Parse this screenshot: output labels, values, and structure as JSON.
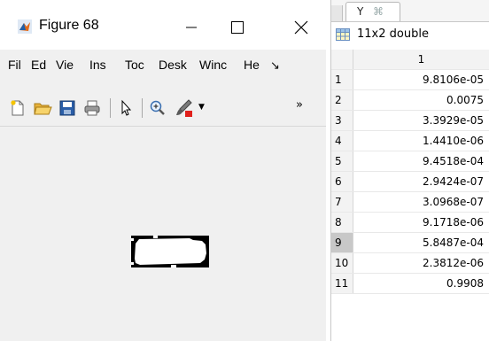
{
  "figure_window": {
    "title": "Figure 68",
    "menu": {
      "file": "Fil",
      "edit": "Ed",
      "view": "Vie",
      "insert": "Ins",
      "tools": "Toc",
      "desktop": "Desk",
      "window": "Winc",
      "help": "He",
      "more": "↘"
    },
    "toolbar": {
      "icons": [
        "new-figure-icon",
        "open-folder-icon",
        "save-icon",
        "print-icon",
        "pointer-icon",
        "zoom-in-icon",
        "brush-icon"
      ],
      "overflow": "»"
    },
    "window_buttons": [
      "minimize-icon",
      "maximize-icon",
      "close-icon"
    ]
  },
  "variable_editor": {
    "tab_label": "Y",
    "tab_close_glyph": "⌘",
    "info_label": "11x2 double",
    "column_headers": [
      "1"
    ],
    "rows": [
      {
        "index": "1",
        "value": "9.8106e-05"
      },
      {
        "index": "2",
        "value": "0.0075"
      },
      {
        "index": "3",
        "value": "3.3929e-05"
      },
      {
        "index": "4",
        "value": "1.4410e-06"
      },
      {
        "index": "5",
        "value": "9.4518e-04"
      },
      {
        "index": "6",
        "value": "2.9424e-07"
      },
      {
        "index": "7",
        "value": "3.0968e-07"
      },
      {
        "index": "8",
        "value": "9.1718e-06"
      },
      {
        "index": "9",
        "value": "5.8487e-04"
      },
      {
        "index": "10",
        "value": "2.3812e-06"
      },
      {
        "index": "11",
        "value": "0.9908"
      }
    ],
    "selected_row_index": "9"
  },
  "colors": {
    "matlab_icon_orange": "#e06a1b",
    "matlab_icon_blue": "#1f5fa8",
    "brush_red": "#e0201b"
  }
}
